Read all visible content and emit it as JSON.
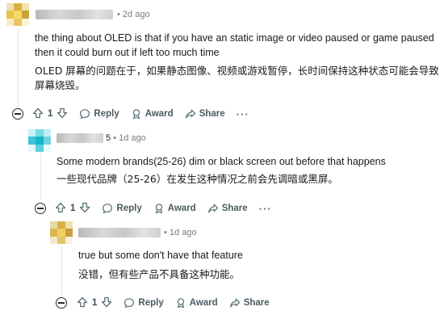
{
  "comments": [
    {
      "author": "",
      "time": "2d ago",
      "body_en": "the thing about OLED is that if you have an static image or video paused or game paused",
      "body_en_2": "then it could burn out if left too much time",
      "body_zh": "OLED 屏幕的问题在于，如果静态图像、视频或游戏暂停，长时间保持这种状态可能会导致",
      "body_zh_2": "屏幕烧毁。",
      "votes": "1",
      "actions": {
        "reply": "Reply",
        "award": "Award",
        "share": "Share",
        "more": "···"
      }
    },
    {
      "author_suffix": "5",
      "time": "1d ago",
      "body_en": "Some modern brands(25-26) dim or black screen out before that happens",
      "body_zh": "一些现代品牌（25-26）在发生这种情况之前会先调暗或黑屏。",
      "votes": "1",
      "actions": {
        "reply": "Reply",
        "award": "Award",
        "share": "Share",
        "more": "···"
      }
    },
    {
      "author": "",
      "time": "1d ago",
      "body_en": "true but some don't have that feature",
      "body_zh": "没错，但有些产品不具备这种功能。",
      "votes": "1",
      "actions": {
        "reply": "Reply",
        "award": "Award",
        "share": "Share"
      }
    }
  ],
  "separator": "•",
  "colors": {
    "meta": "#7c7c7c",
    "action": "#576f76",
    "thread_line": "#e3e5e8"
  },
  "icons": [
    "upvote-icon",
    "downvote-icon",
    "reply-bubble-icon",
    "award-icon",
    "share-icon",
    "collapse-icon"
  ]
}
